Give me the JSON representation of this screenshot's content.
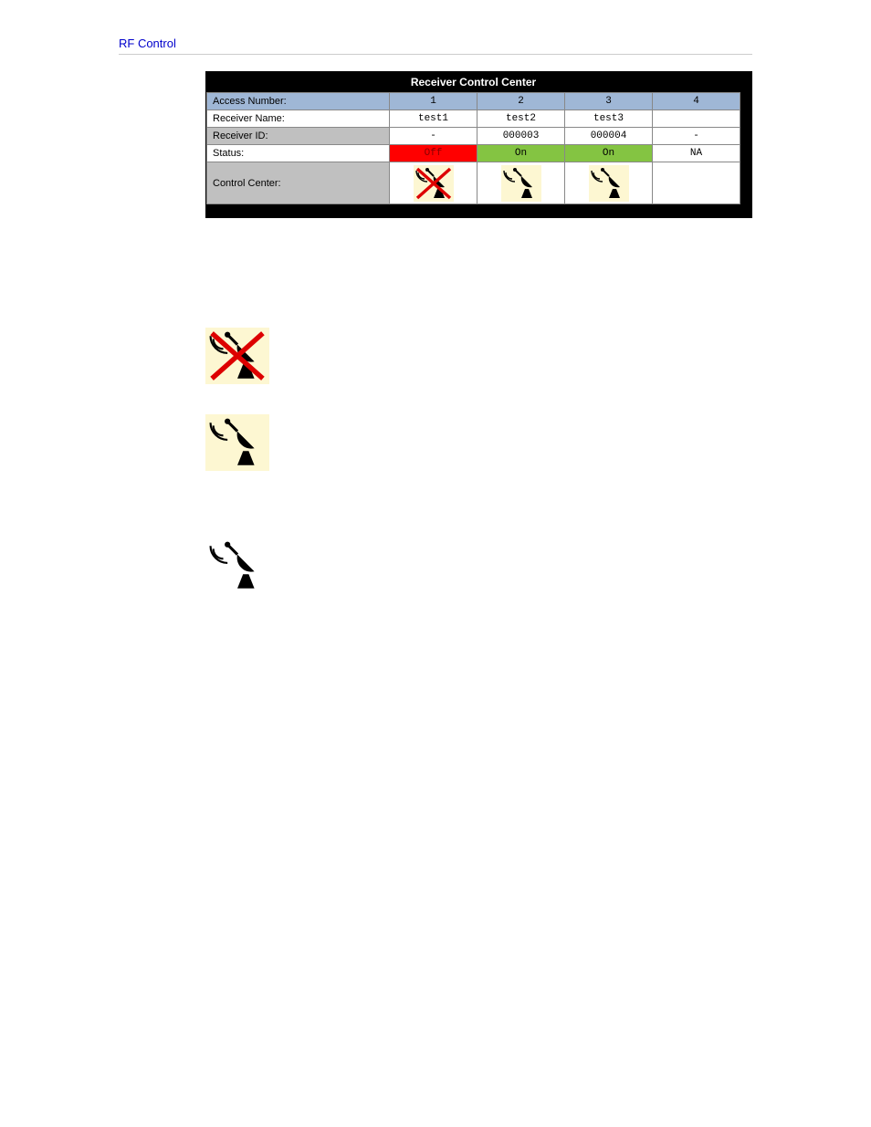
{
  "section_title": "RF Control",
  "table": {
    "title": "Receiver Control Center",
    "rows": {
      "access": {
        "label": "Access Number:",
        "c1": "1",
        "c2": "2",
        "c3": "3",
        "c4": "4"
      },
      "name": {
        "label": "Receiver Name:",
        "c1": "test1",
        "c2": "test2",
        "c3": "test3",
        "c4": ""
      },
      "id": {
        "label": "Receiver ID:",
        "c1": "-",
        "c2": "000003",
        "c3": "000004",
        "c4": "-"
      },
      "status": {
        "label": "Status:",
        "c1": "Off",
        "c2": "On",
        "c3": "On",
        "c4": "NA"
      },
      "control": {
        "label": "Control Center:"
      }
    }
  }
}
